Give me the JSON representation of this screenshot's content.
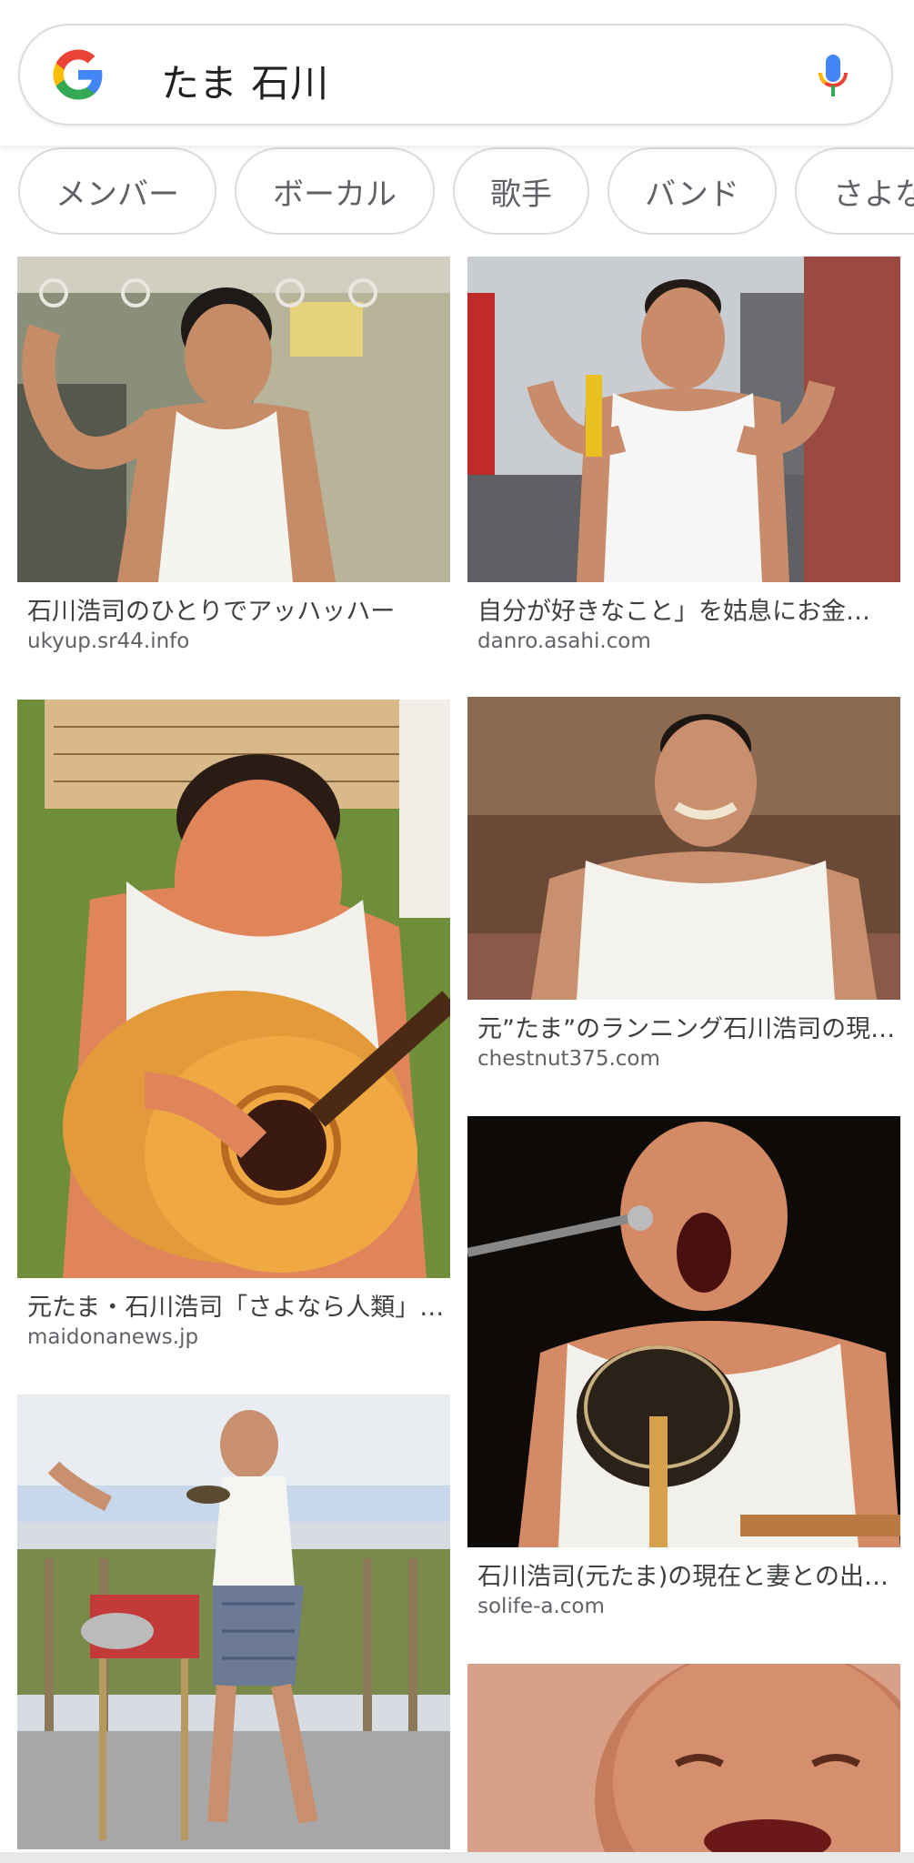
{
  "search": {
    "query": "たま 石川"
  },
  "chips": [
    {
      "label": "メンバー"
    },
    {
      "label": "ボーカル"
    },
    {
      "label": "歌手"
    },
    {
      "label": "バンド"
    },
    {
      "label": "さよな"
    }
  ],
  "results": [
    {
      "title": "石川浩司のひとりでアッハッハー",
      "domain": "ukyup.sr44.info"
    },
    {
      "title": "自分が好きなこと」を姑息にお金…",
      "domain": "danro.asahi.com"
    },
    {
      "title": "元たま・石川浩司「さよなら人類」…",
      "domain": "maidonanews.jp"
    },
    {
      "title": "元”たま”のランニング石川浩司の現…",
      "domain": "chestnut375.com"
    },
    {
      "title": "石川浩司(元たま)の現在と妻との出…",
      "domain": "solife-a.com"
    }
  ]
}
